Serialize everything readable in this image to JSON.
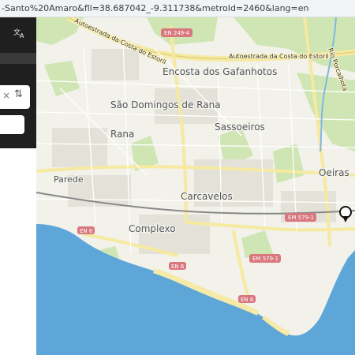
{
  "browser": {
    "url_fragment": "-Santo%20Amaro&fll=38.687042_-9.311738&metroId=2460&lang=en"
  },
  "sidebar": {
    "translate_icon": "translate-icon",
    "clear_icon_glyph": "×",
    "swap_icon_glyph": "⇅"
  },
  "map": {
    "places": [
      {
        "name": "Encosta dos Gafanhotos",
        "size": "big"
      },
      {
        "name": "São Domingos de Rana",
        "size": "big"
      },
      {
        "name": "Sassoeiros",
        "size": "big"
      },
      {
        "name": "Rana",
        "size": "big"
      },
      {
        "name": "Parede",
        "size": "mid"
      },
      {
        "name": "Carcavelos",
        "size": "big"
      },
      {
        "name": "Complexo",
        "size": "big"
      },
      {
        "name": "Oeiras",
        "size": "big"
      }
    ],
    "road_labels": [
      {
        "text": "Autoestrada da Costa do Estoril"
      },
      {
        "text": "Autoestrada da Costa do Estoril"
      },
      {
        "text": "Rio Porcalhota"
      }
    ],
    "shields": [
      {
        "text": "EN 249-4"
      },
      {
        "text": "EM 579-1"
      },
      {
        "text": "EM 579-1"
      },
      {
        "text": "EN 6"
      },
      {
        "text": "EN 6"
      },
      {
        "text": "EN 6"
      }
    ],
    "colors": {
      "land": "#f2f1ea",
      "water": "#5ea6d8",
      "beach": "#f7e9a8",
      "park": "#cfe6b4",
      "road": "#ffffff",
      "major_road": "#f6e9a0",
      "shield": "#d9777e",
      "railway": "#888888"
    },
    "marker_icon": "map-pin-icon"
  }
}
